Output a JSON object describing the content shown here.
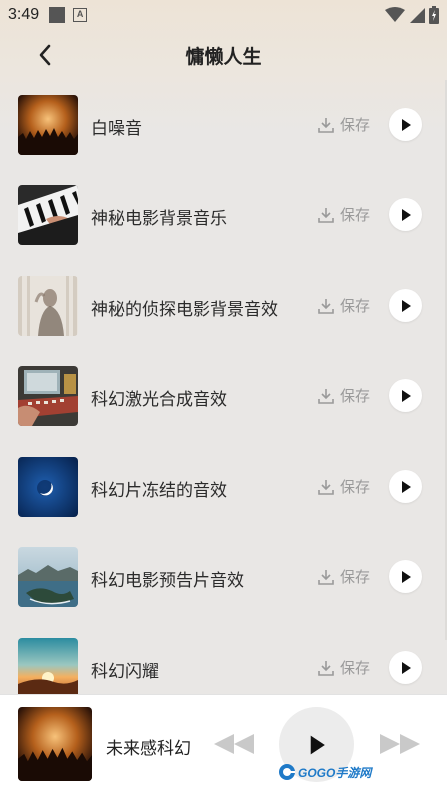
{
  "status_bar": {
    "time": "3:49",
    "notification_icons": [
      "square-icon",
      "a-icon"
    ],
    "system_icons": [
      "wifi-icon",
      "signal-icon",
      "battery-icon"
    ]
  },
  "header": {
    "title": "慵懒人生",
    "back_icon": "chevron-left-icon"
  },
  "tracks": [
    {
      "title": "白噪音",
      "save_label": "保存",
      "thumb": "concert-crowd"
    },
    {
      "title": "神秘电影背景音乐",
      "save_label": "保存",
      "thumb": "piano-keys"
    },
    {
      "title": "神秘的侦探电影背景音效",
      "save_label": "保存",
      "thumb": "blurred-figure"
    },
    {
      "title": "科幻激光合成音效",
      "save_label": "保存",
      "thumb": "synth-desk"
    },
    {
      "title": "科幻片冻结的音效",
      "save_label": "保存",
      "thumb": "moon-night"
    },
    {
      "title": "科幻电影预告片音效",
      "save_label": "保存",
      "thumb": "coastal-island"
    },
    {
      "title": "科幻闪耀",
      "save_label": "保存",
      "thumb": "sunset-hills"
    }
  ],
  "player": {
    "now_playing": "未来感科幻",
    "thumb": "concert-crowd"
  },
  "watermark": {
    "text": "GOGO手游网"
  },
  "colors": {
    "background": "#e9e7e5",
    "save_text": "#9a9a9a",
    "accent": "#111111"
  }
}
